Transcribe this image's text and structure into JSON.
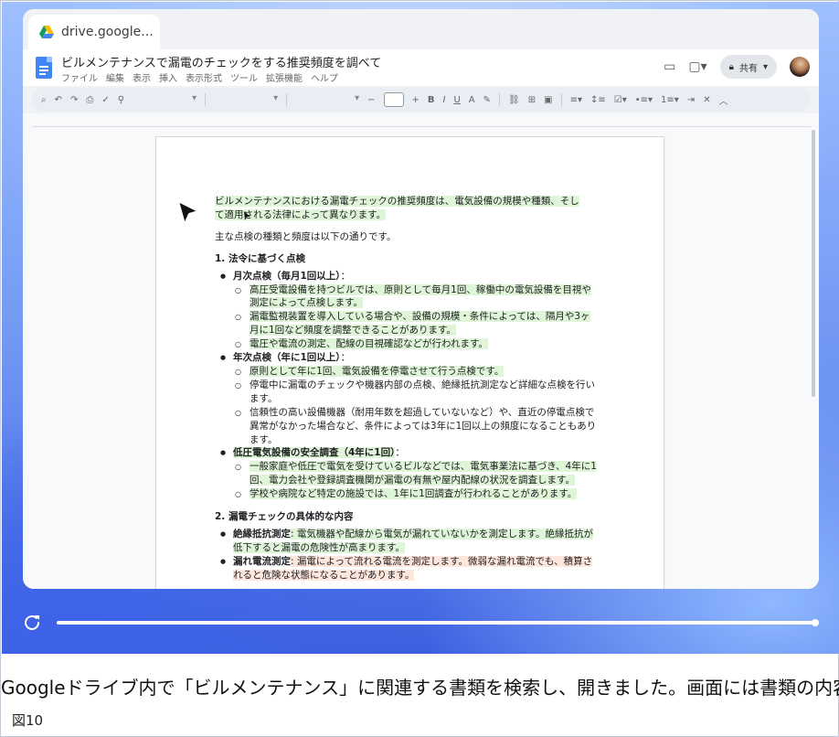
{
  "browser": {
    "tab_title": "drive.google...",
    "tab_icon": "google-drive-icon"
  },
  "doc": {
    "title": "ビルメンテナンスで漏電のチェックをする推奨頻度を調べて",
    "menu": [
      "ファイル",
      "編集",
      "表示",
      "挿入",
      "表示形式",
      "ツール",
      "拡張機能",
      "ヘルプ"
    ],
    "share_label": "共有",
    "toolbar_icons": [
      "search-icon",
      "undo-icon",
      "redo-icon",
      "print-icon",
      "spellcheck-icon",
      "paint-format-icon",
      "bold-icon",
      "italic-icon",
      "underline-icon",
      "text-color-icon",
      "highlight-icon",
      "link-icon",
      "comment-icon",
      "image-icon",
      "align-icon",
      "line-spacing-icon",
      "checklist-icon",
      "bullet-list-icon",
      "numbered-list-icon",
      "indent-icon",
      "clear-format-icon"
    ],
    "toolbar_glyphs": {
      "bold": "B",
      "italic": "I",
      "underline": "U",
      "text_color": "A",
      "minus": "−",
      "plus": "+"
    }
  },
  "content": {
    "intro_line1": "ビルメンテナンスにおける漏電チェックの推奨頻度は、電気設備の規模や種類、そし",
    "intro_line2": "て適用される法律によって異なります。",
    "lead": "主な点検の種類と頻度は以下の通りです。",
    "section1": "1. 法令に基づく点検",
    "monthly_title": "月次点検（毎月1回以上）",
    "monthly_items": [
      "高圧受電設備を持つビルでは、原則として毎月1回、稼働中の電気設備を目視や測定によって点検します。",
      "漏電監視装置を導入している場合や、設備の規模・条件によっては、隔月や3ヶ月に1回など頻度を調整できることがあります。",
      "電圧や電流の測定、配線の目視確認などが行われます。"
    ],
    "yearly_title": "年次点検（年に1回以上）",
    "yearly_items": [
      "原則として年に1回、電気設備を停電させて行う点検です。",
      "停電中に漏電のチェックや機器内部の点検、絶縁抵抗測定など詳細な点検を行います。",
      "信頼性の高い設備機器（耐用年数を超過していないなど）や、直近の停電点検で異常がなかった場合など、条件によっては3年に1回以上の頻度になることもあります。"
    ],
    "lowvolt_title": "低圧電気設備の安全調査（4年に1回）",
    "lowvolt_items": [
      "一般家庭や低圧で電気を受けているビルなどでは、電気事業法に基づき、4年に1回、電力会社や登録調査機関が漏電の有無や屋内配線の状況を調査します。",
      "学校や病院など特定の施設では、1年に1回調査が行われることがあります。"
    ],
    "section2": "2. 漏電チェックの具体的な内容",
    "insulation_title": "絶縁抵抗測定",
    "insulation_text": ": 電気機器や配線から電気が漏れていないかを測定します。絶縁抵抗が低下すると漏電の危険性が高まります。",
    "leak_title": "漏れ電流測定",
    "leak_text": ": 漏電によって流れる電流を測定します。微弱な漏れ電流でも、積算されると危険な状態になることがあります。"
  },
  "player": {
    "progress": 1.0
  },
  "caption": "Googleドライブ内で「ビルメンテナンス」に関連する書類を検索し、開きました。画面には書類の内容",
  "figure_label": "図10",
  "colors": {
    "highlight_green": "#dff5d8",
    "highlight_pink": "#fde6dc",
    "docs_blue": "#4285f4"
  }
}
